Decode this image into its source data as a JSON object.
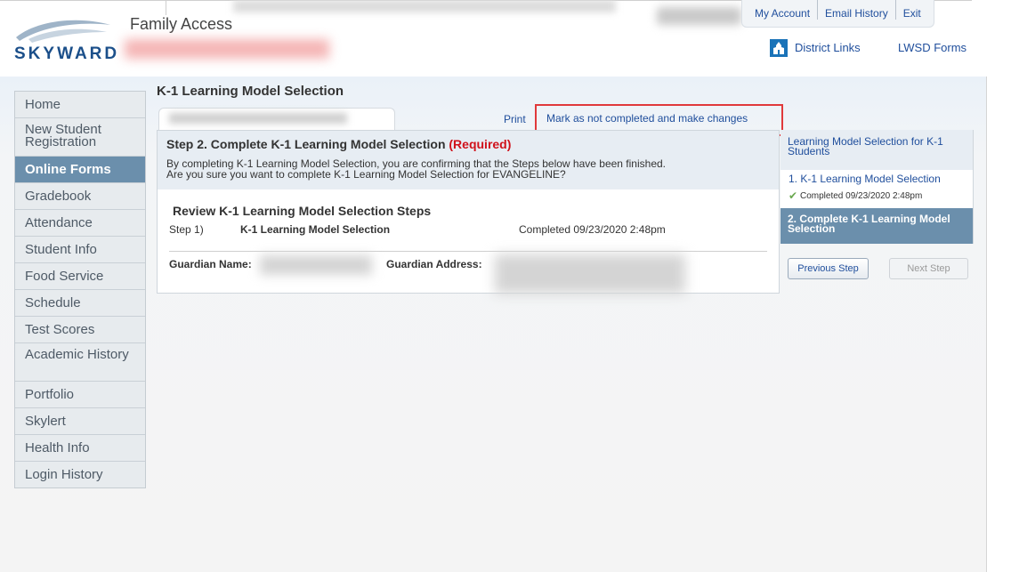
{
  "header": {
    "app_name": "Family Access",
    "logo_text": "SKYWARD",
    "top_links": [
      "My Account",
      "Email History",
      "Exit"
    ],
    "district_links": "District Links",
    "lwsd_forms": "LWSD Forms"
  },
  "sidebar": {
    "items": [
      {
        "label": "Home",
        "active": false
      },
      {
        "label": "New Student Registration",
        "active": false
      },
      {
        "label": "Online Forms",
        "active": true
      },
      {
        "label": "Gradebook",
        "active": false
      },
      {
        "label": "Attendance",
        "active": false
      },
      {
        "label": "Student Info",
        "active": false
      },
      {
        "label": "Food Service",
        "active": false
      },
      {
        "label": "Schedule",
        "active": false
      },
      {
        "label": "Test Scores",
        "active": false
      },
      {
        "label": "Academic History",
        "active": false
      },
      {
        "label": "Portfolio",
        "active": false
      },
      {
        "label": "Skylert",
        "active": false
      },
      {
        "label": "Health Info",
        "active": false
      },
      {
        "label": "Login History",
        "active": false
      }
    ]
  },
  "main": {
    "page_title": "K-1 Learning Model Selection",
    "print_label": "Print",
    "mark_label": "Mark as not completed and make changes",
    "step_title": "Step 2. Complete K-1 Learning Model Selection",
    "required_label": "(Required)",
    "confirm_line1": "By completing K-1 Learning Model Selection, you are confirming that the Steps below have been finished.",
    "confirm_line2": "Are you sure you want to complete K-1 Learning Model Selection for EVANGELINE?",
    "review_title": "Review K-1 Learning Model Selection Steps",
    "steps": [
      {
        "number": "Step 1)",
        "name": "K-1 Learning Model Selection",
        "status": "Completed 09/23/2020 2:48pm"
      }
    ],
    "guardian_name_label": "Guardian Name:",
    "guardian_address_label": "Guardian Address:"
  },
  "steps_panel": {
    "header": "Learning Model Selection for K-1 Students",
    "step1_label": "1. K-1 Learning Model Selection",
    "step1_completed": "Completed 09/23/2020 2:48pm",
    "step2_label": "2. Complete K-1 Learning Model Selection",
    "previous_label": "Previous Step",
    "next_label": "Next Step"
  },
  "colors": {
    "accent": "#6b8fac",
    "link": "#1f4e9c",
    "required": "#d0121b",
    "highlight": "#e0393b"
  }
}
